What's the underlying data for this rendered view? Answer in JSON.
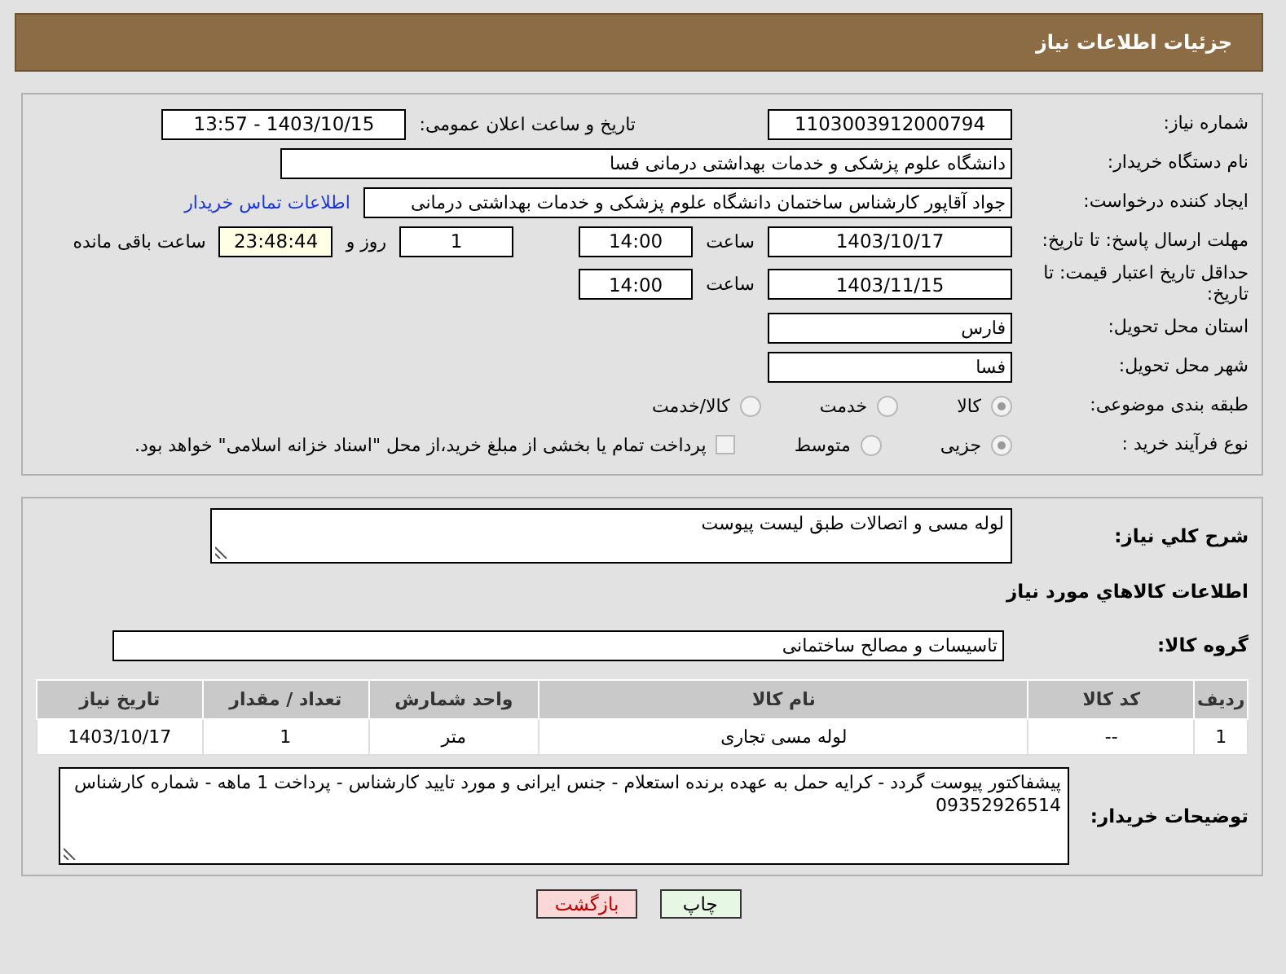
{
  "header": {
    "title": "جزئیات اطلاعات نیاز"
  },
  "need_number": {
    "label": "شماره نیاز:",
    "value": "1103003912000794"
  },
  "announce_datetime": {
    "label": "تاریخ و ساعت اعلان عمومی:",
    "value": "1403/10/15 - 13:57"
  },
  "buyer_org": {
    "label": "نام دستگاه خریدار:",
    "value": "دانشگاه علوم پزشکی و خدمات بهداشتی درمانی فسا"
  },
  "requester": {
    "label": "ایجاد کننده درخواست:",
    "value": "جواد آقاپور کارشناس ساختمان دانشگاه علوم پزشکی و خدمات بهداشتی درمانی",
    "link": "اطلاعات تماس خریدار"
  },
  "reply_deadline": {
    "label": "مهلت ارسال پاسخ: تا تاریخ:",
    "date": "1403/10/17",
    "time_label": "ساعت",
    "time": "14:00",
    "days": "1",
    "days_label": "روز و",
    "remaining": "23:48:44",
    "remaining_label": "ساعت باقی مانده"
  },
  "price_validity": {
    "label": "حداقل تاریخ اعتبار قیمت: تا تاریخ:",
    "date": "1403/11/15",
    "time_label": "ساعت",
    "time": "14:00"
  },
  "province": {
    "label": "استان محل تحویل:",
    "value": "فارس"
  },
  "city": {
    "label": "شهر محل تحویل:",
    "value": "فسا"
  },
  "category": {
    "label": "طبقه بندی موضوعی:",
    "options": [
      {
        "label": "کالا",
        "selected": true
      },
      {
        "label": "خدمت",
        "selected": false
      },
      {
        "label": "کالا/خدمت",
        "selected": false
      }
    ]
  },
  "process": {
    "label": "نوع فرآیند خرید :",
    "options": [
      {
        "label": "جزیی",
        "selected": true
      },
      {
        "label": "متوسط",
        "selected": false
      }
    ],
    "payment": {
      "checked": false,
      "text": "پرداخت تمام یا بخشی از مبلغ خرید،از محل \"اسناد خزانه اسلامی\" خواهد بود."
    }
  },
  "description": {
    "label": "شرح کلي نياز:",
    "value": "لوله مسی و اتصالات طبق لیست پیوست"
  },
  "goods_title": "اطلاعات کالاهاي مورد نياز",
  "goods_group": {
    "label": "گروه کالا:",
    "value": "تاسیسات و مصالح ساختمانی"
  },
  "table": {
    "columns": [
      "ردیف",
      "کد کالا",
      "نام کالا",
      "واحد شمارش",
      "تعداد / مقدار",
      "تاریخ نیاز"
    ],
    "rows": [
      [
        "1",
        "--",
        "لوله مسی تجاری",
        "متر",
        "1",
        "1403/10/17"
      ]
    ]
  },
  "buyer_notes": {
    "label": "توضیحات خریدار:",
    "value": "پیشفاکتور پیوست گردد - کرایه حمل به عهده برنده استعلام - جنس ایرانی و مورد تایید کارشناس - پرداخت 1 ماهه - شماره کارشناس 09352926514"
  },
  "buttons": [
    {
      "label": "چاپ",
      "kind": "print"
    },
    {
      "label": "بازگشت",
      "kind": "back"
    }
  ]
}
